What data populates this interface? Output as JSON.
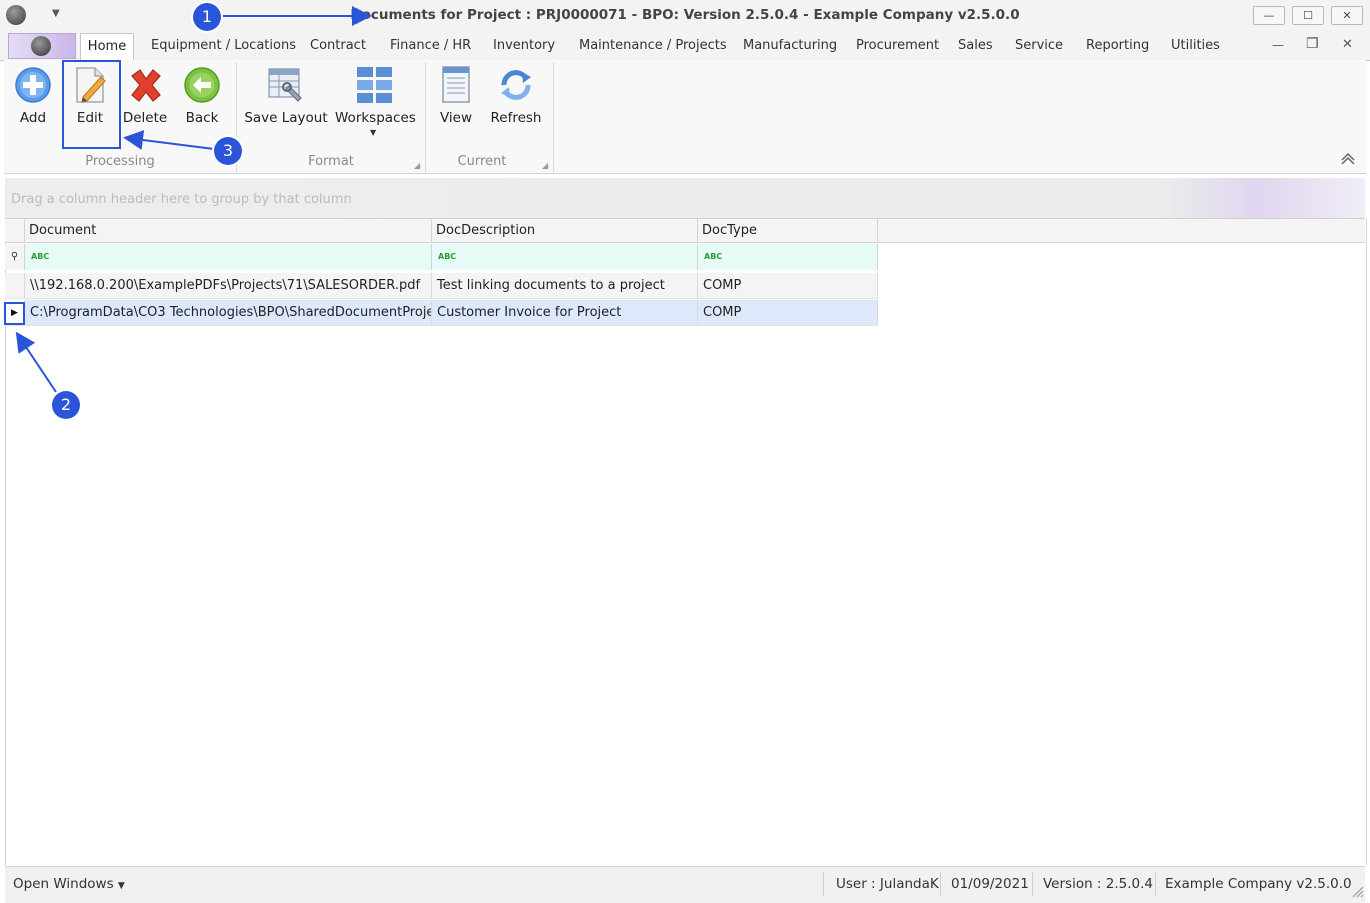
{
  "window": {
    "title": "Documents for Project : PRJ0000071 - BPO: Version 2.5.0.4 - Example Company v2.5.0.0",
    "minimize": "—",
    "maximize": "☐",
    "close": "✕"
  },
  "tabs": [
    "Home",
    "Equipment / Locations",
    "Contract",
    "Finance / HR",
    "Inventory",
    "Maintenance / Projects",
    "Manufacturing",
    "Procurement",
    "Sales",
    "Service",
    "Reporting",
    "Utilities"
  ],
  "mdi_controls": {
    "minimize": "—",
    "restore": "❐",
    "close": "✕"
  },
  "ribbon": {
    "processing": {
      "label": "Processing",
      "add": "Add",
      "edit": "Edit",
      "delete": "Delete",
      "back": "Back"
    },
    "format": {
      "label": "Format",
      "save_layout": "Save Layout",
      "workspaces": "Workspaces"
    },
    "current": {
      "label": "Current",
      "view": "View",
      "refresh": "Refresh"
    }
  },
  "grid": {
    "group_hint": "Drag a column header here to group by that column",
    "columns": [
      "Document",
      "DocDescription",
      "DocType"
    ],
    "filter_icon": "ABC",
    "rows": [
      {
        "document": "\\\\192.168.0.200\\ExamplePDFs\\Projects\\71\\SALESORDER.pdf",
        "description": "Test linking documents to a project",
        "type": "COMP"
      },
      {
        "document": "C:\\ProgramData\\CO3 Technologies\\BPO\\SharedDocumentProje...",
        "description": "Customer Invoice for Project",
        "type": "COMP"
      }
    ]
  },
  "status": {
    "open_windows": "Open Windows",
    "user": "User : JulandaK",
    "date": "01/09/2021",
    "version": "Version : 2.5.0.4",
    "company": "Example Company v2.5.0.0"
  },
  "annotations": [
    "1",
    "2",
    "3"
  ],
  "colors": {
    "accent": "#2b55d8",
    "selected_row": "#dde8fb",
    "filter_row": "#e6fbf6"
  },
  "icons": [
    "app-logo-icon",
    "quick-access-icon",
    "add-icon",
    "edit-icon",
    "delete-icon",
    "back-icon",
    "save-layout-icon",
    "workspaces-icon",
    "view-icon",
    "refresh-icon",
    "collapse-ribbon-icon",
    "filter-pin-icon",
    "row-indicator-icon",
    "size-grip-icon"
  ]
}
